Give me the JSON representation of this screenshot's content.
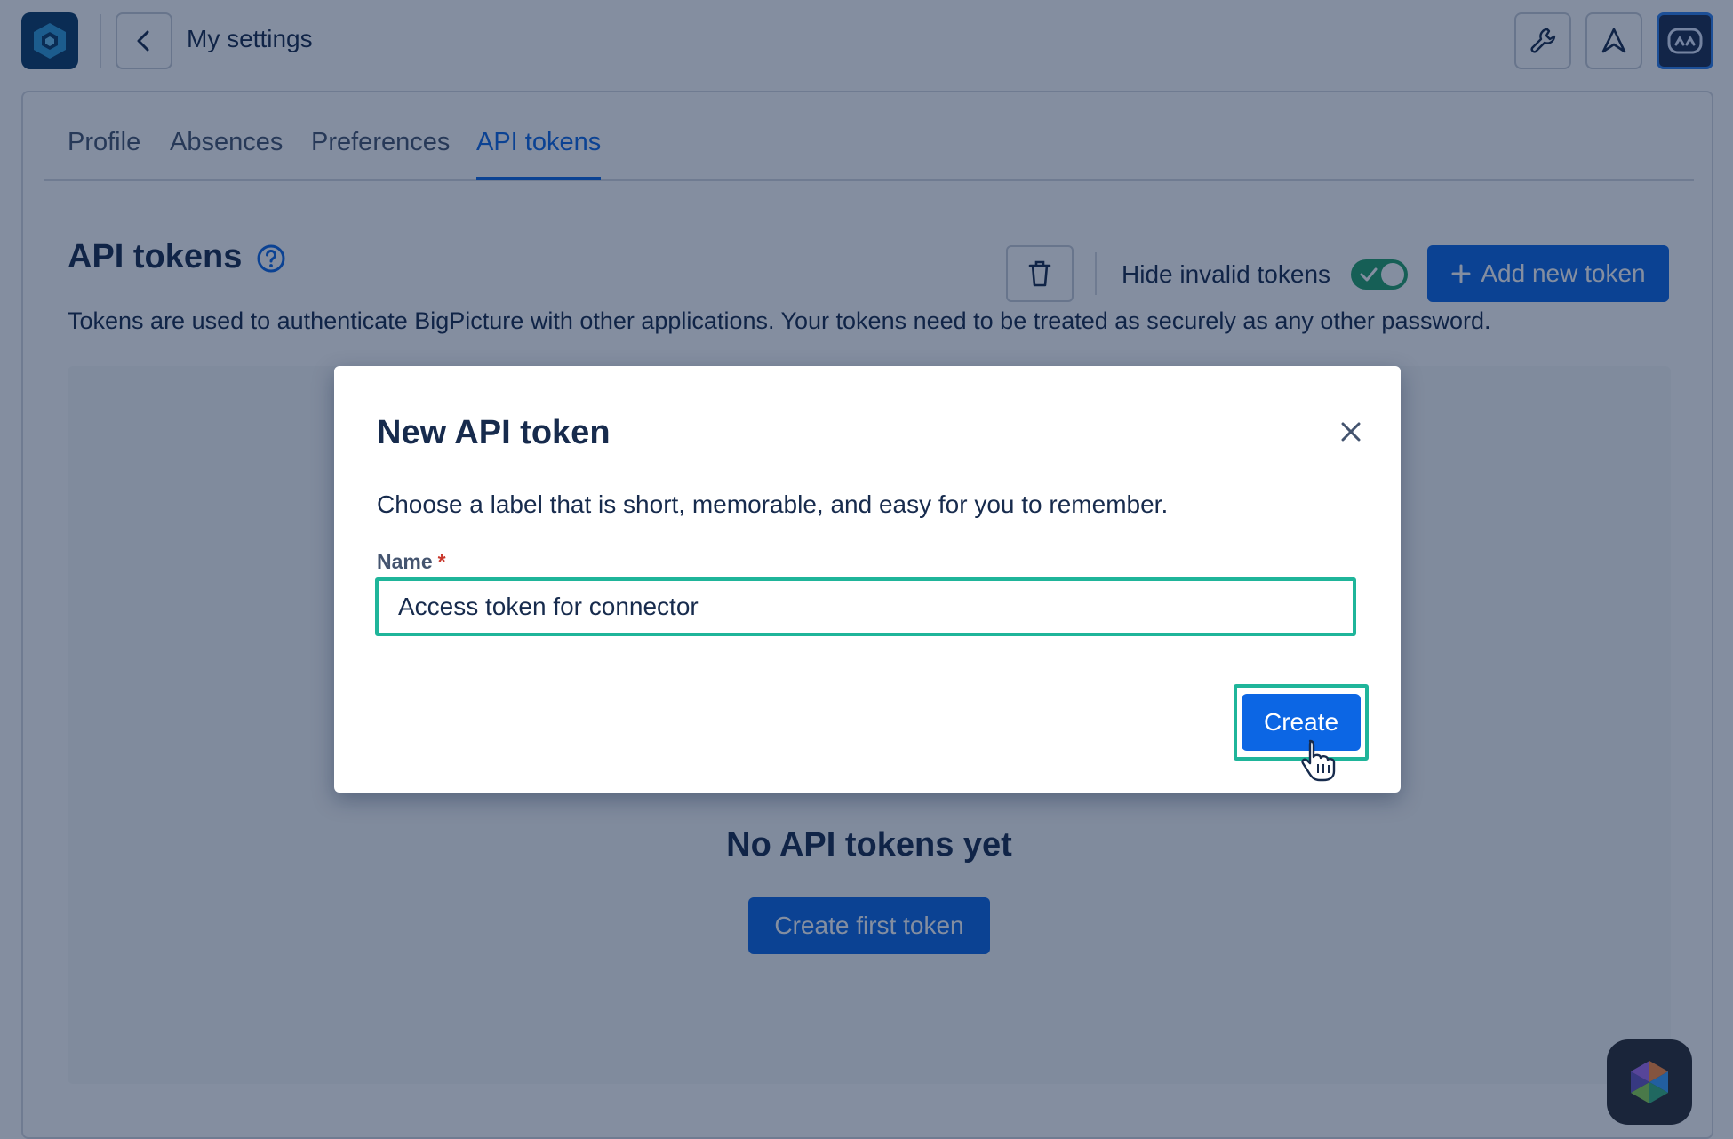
{
  "header": {
    "title": "My settings",
    "icons": [
      "app-logo-icon",
      "back-chevron-icon",
      "wrench-icon",
      "notification-arrow-icon",
      "user-avatar-icon"
    ]
  },
  "tabs": [
    {
      "label": "Profile",
      "active": false
    },
    {
      "label": "Absences",
      "active": false
    },
    {
      "label": "Preferences",
      "active": false
    },
    {
      "label": "API tokens",
      "active": true
    }
  ],
  "section": {
    "title": "API tokens",
    "description": "Tokens are used to authenticate BigPicture with other applications. Your tokens need to be treated as securely as any other password.",
    "toggle_label": "Hide invalid tokens",
    "toggle_on": true,
    "add_button": "Add new token"
  },
  "empty_state": {
    "title": "No API tokens yet",
    "button": "Create first token"
  },
  "modal": {
    "title": "New API token",
    "description": "Choose a label that is short, memorable, and easy for you to remember.",
    "field_label": "Name",
    "required_marker": "*",
    "field_value": "Access token for connector",
    "create_button": "Create"
  },
  "colors": {
    "primary": "#0c66e4",
    "highlight": "#1fb59a",
    "toggle_on": "#22a06b",
    "overlay": "#091e42"
  }
}
